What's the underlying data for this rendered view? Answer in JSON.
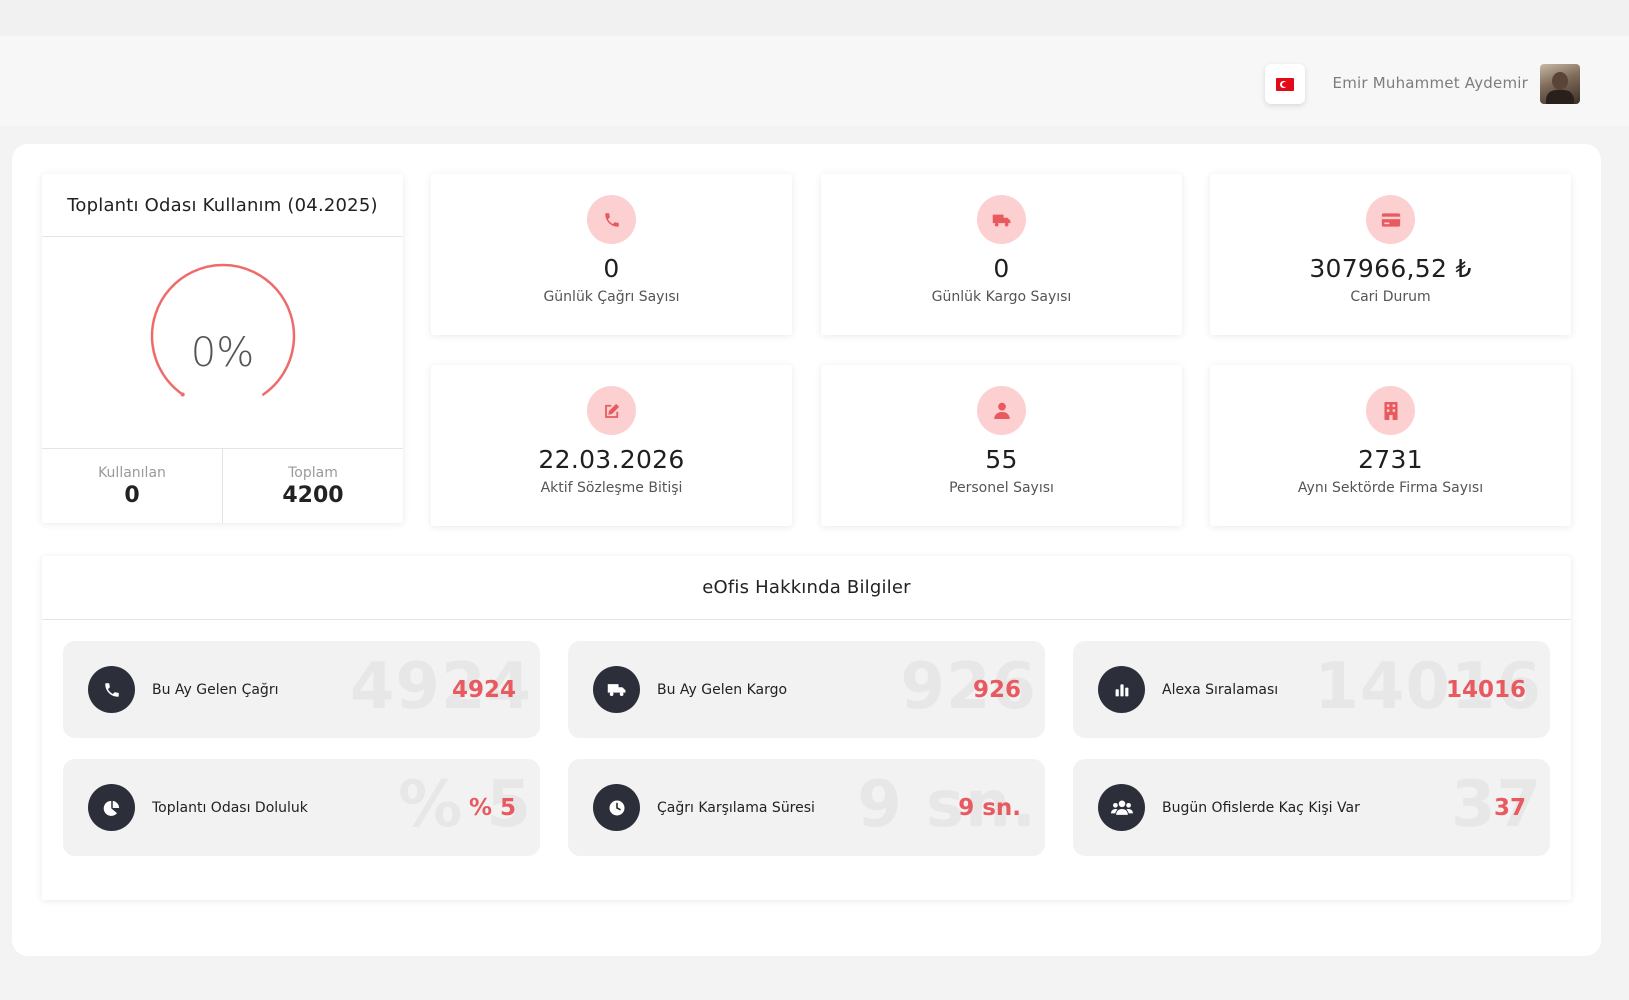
{
  "header": {
    "language_flag": "turkey-flag-icon",
    "user_name": "Emir Muhammet Aydemir"
  },
  "usage_card": {
    "title": "Toplantı Odası Kullanım (04.2025)",
    "percent_label": "0%",
    "percent_value": 0,
    "used_label": "Kullanılan",
    "used_value": "0",
    "total_label": "Toplam",
    "total_value": "4200",
    "gauge_color": "#ef6b6b"
  },
  "stats": [
    {
      "icon": "phone-icon",
      "value": "0",
      "label": "Günlük Çağrı Sayısı"
    },
    {
      "icon": "truck-icon",
      "value": "0",
      "label": "Günlük Kargo Sayısı"
    },
    {
      "icon": "credit-card-icon",
      "value": "307966,52 ₺",
      "label": "Cari Durum"
    },
    {
      "icon": "edit-icon",
      "value": "22.03.2026",
      "label": "Aktif Sözleşme Bitişi"
    },
    {
      "icon": "user-icon",
      "value": "55",
      "label": "Personel Sayısı"
    },
    {
      "icon": "building-icon",
      "value": "2731",
      "label": "Aynı Sektörde Firma Sayısı"
    }
  ],
  "info": {
    "title": "eOfis Hakkında Bilgiler",
    "tiles": [
      {
        "icon": "phone-icon",
        "label": "Bu Ay Gelen Çağrı",
        "value": "4924"
      },
      {
        "icon": "truck-icon",
        "label": "Bu Ay Gelen Kargo",
        "value": "926"
      },
      {
        "icon": "bar-chart-icon",
        "label": "Alexa Sıralaması",
        "value": "14016"
      },
      {
        "icon": "pie-chart-icon",
        "label": "Toplantı Odası Doluluk",
        "value": "% 5"
      },
      {
        "icon": "clock-icon",
        "label": "Çağrı Karşılama Süresi",
        "value": "9 sn."
      },
      {
        "icon": "users-icon",
        "label": "Bugün Ofislerde Kaç Kişi Var",
        "value": "37"
      }
    ]
  },
  "colors": {
    "accent": "#e85a5f",
    "icon_bg_light": "#fcd0d0",
    "icon_bg_dark": "#2c2f3a"
  }
}
